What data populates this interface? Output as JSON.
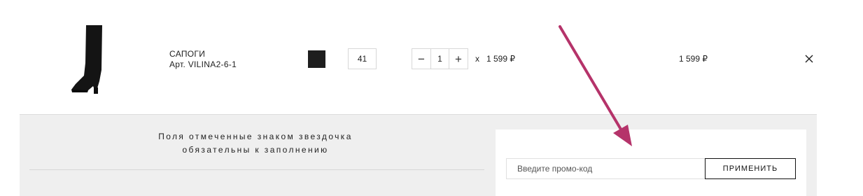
{
  "cart_item": {
    "image_icon": "boot-image",
    "name": "САПОГИ",
    "article": "Арт. VILINA2-6-1",
    "color_swatch": "#1e1e1e",
    "size": "41",
    "quantity": "1",
    "minus_label": "−",
    "plus_label": "+",
    "times": "x",
    "unit_price": "1 599 ₽",
    "total_price": "1 599 ₽",
    "remove_icon": "close-icon"
  },
  "form_notice": {
    "line1": "Поля отмеченные знаком звездочка",
    "line2": "обязательны к заполнению"
  },
  "promo": {
    "placeholder": "Введите промо-код",
    "apply_label": "ПРИМЕНИТЬ"
  },
  "annotation": {
    "arrow_color": "#b5336a"
  }
}
